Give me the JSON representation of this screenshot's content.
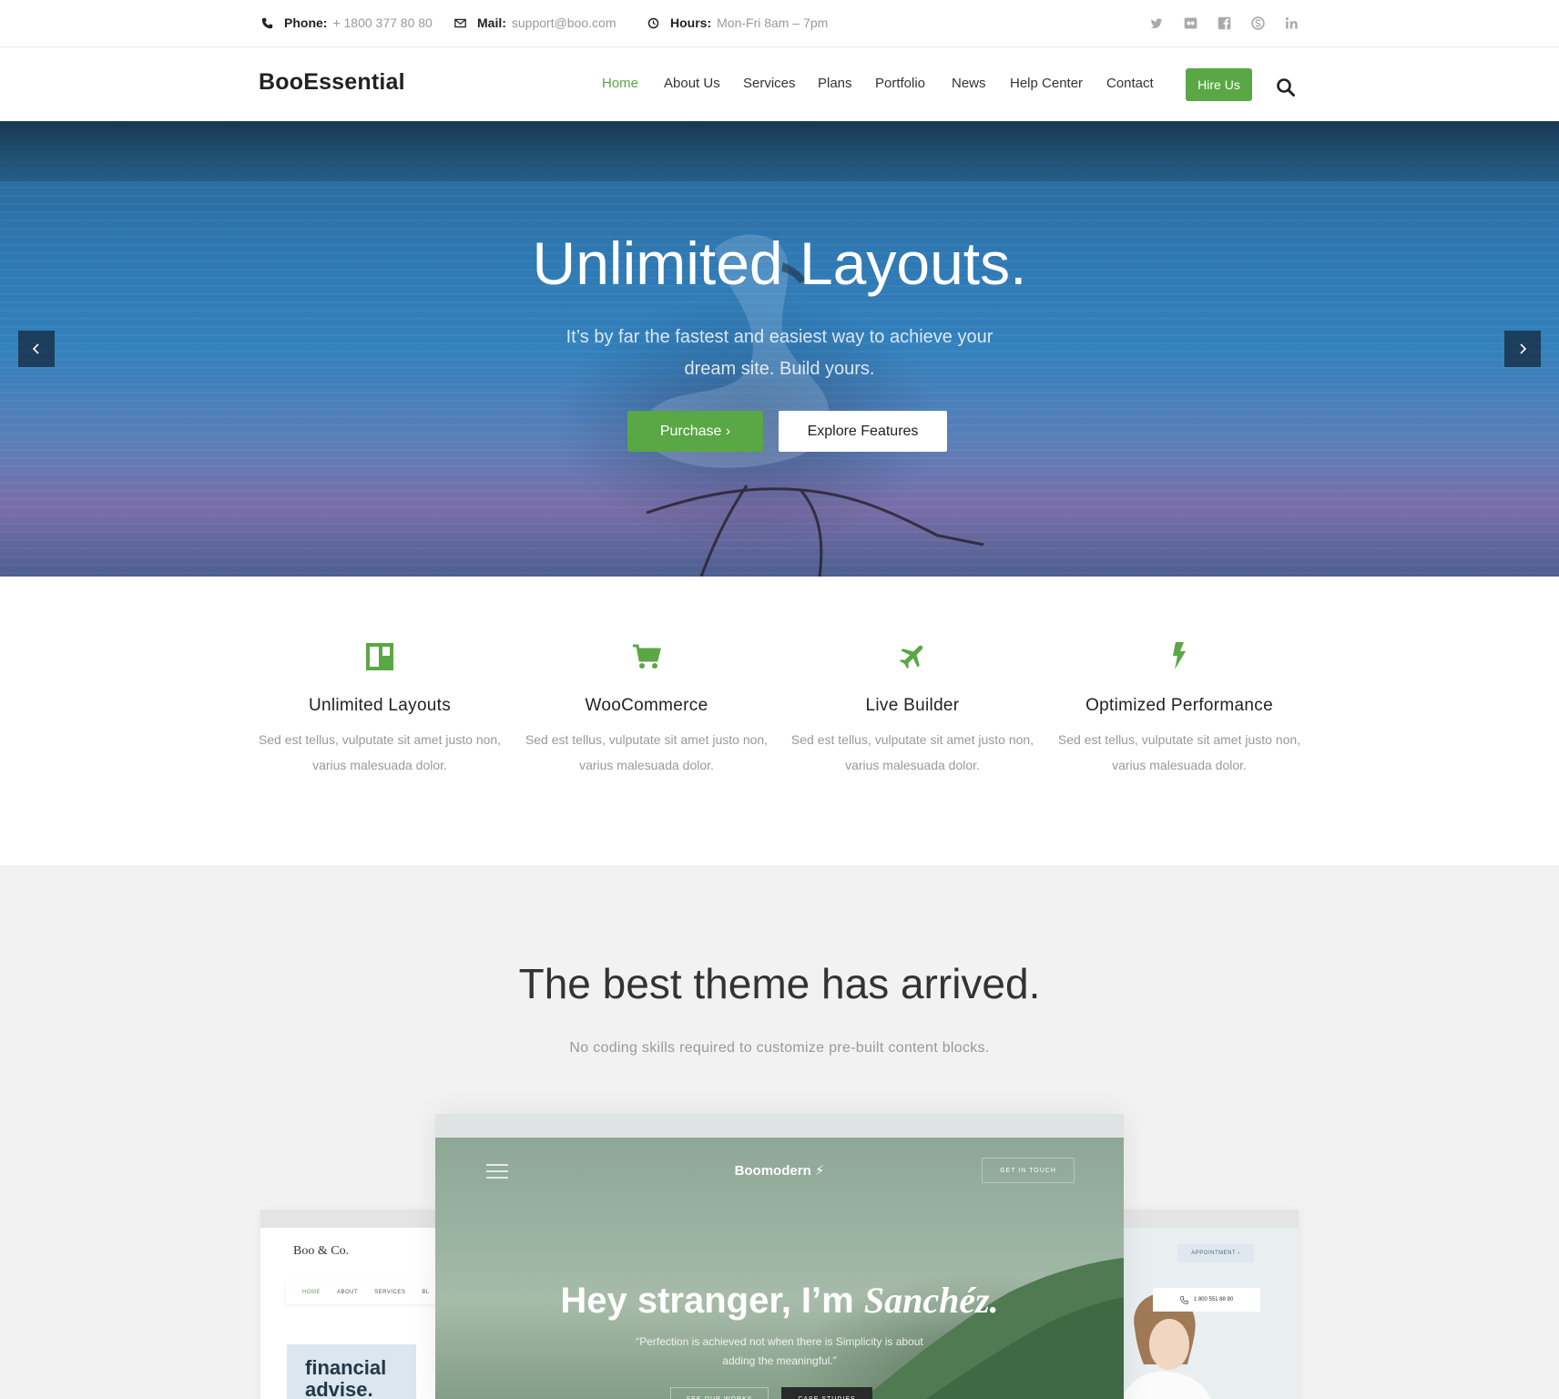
{
  "topbar": {
    "phone": {
      "label": "Phone:",
      "value": "+ 1800 377 80 80",
      "icon": "phone-icon"
    },
    "mail": {
      "label": "Mail:",
      "value": "support@boo.com",
      "icon": "envelope-icon"
    },
    "hours": {
      "label": "Hours:",
      "value": "Mon-Fri 8am – 7pm",
      "icon": "clock-icon"
    },
    "social": [
      "twitter-icon",
      "flickr-icon",
      "facebook-icon",
      "skype-icon",
      "linkedin-icon"
    ]
  },
  "header": {
    "logo": "BooEssential",
    "nav": [
      "Home",
      "About Us",
      "Services",
      "Plans",
      "Portfolio",
      "News",
      "Help Center",
      "Contact"
    ],
    "active_nav": "Home",
    "hire_label": "Hire Us",
    "search_icon": "search-icon"
  },
  "hero": {
    "title": "Unlimited Layouts.",
    "subtitle": "It’s by far the fastest and easiest way to achieve your dream site. Build yours.",
    "purchase_label": "Purchase ›",
    "explore_label": "Explore Features"
  },
  "features": [
    {
      "icon": "layout-icon",
      "title": "Unlimited Layouts",
      "text": "Sed est tellus, vulputate sit amet justo non, varius malesuada dolor."
    },
    {
      "icon": "cart-icon",
      "title": "WooCommerce",
      "text": "Sed est tellus, vulputate sit amet justo non, varius malesuada dolor."
    },
    {
      "icon": "plane-icon",
      "title": "Live Builder",
      "text": "Sed est tellus, vulputate sit amet justo non, varius malesuada dolor."
    },
    {
      "icon": "bolt-icon",
      "title": "Optimized Performance",
      "text": "Sed est tellus, vulputate sit amet justo non, varius malesuada dolor."
    }
  ],
  "theme": {
    "title": "The best theme has arrived.",
    "subtitle": "No coding skills required to customize pre-built content blocks.",
    "center_mock": {
      "brand": "Boomodern ⚡",
      "touch": "GET IN TOUCH",
      "hey": "Hey stranger, I’m",
      "hey_name": "Sanchéz.",
      "quote": "“Perfection is achieved not when there is Simplicity is about adding the meaningful.”",
      "btn1": "SEE OUR WORKS",
      "btn2": "CASE STUDIES"
    },
    "left_mock": {
      "brand": "Boo & Co.",
      "nav": [
        "HOME",
        "ABOUT",
        "SERVICES",
        "BL"
      ],
      "headline": "financial advise."
    },
    "right_mock": {
      "appointment": "APPOINTMENT ›",
      "phone": "1 800 551 88 90"
    }
  },
  "colors": {
    "accent": "#5aa745",
    "dark": "#222222",
    "muted": "#999999",
    "section_bg": "#f2f2f2"
  }
}
